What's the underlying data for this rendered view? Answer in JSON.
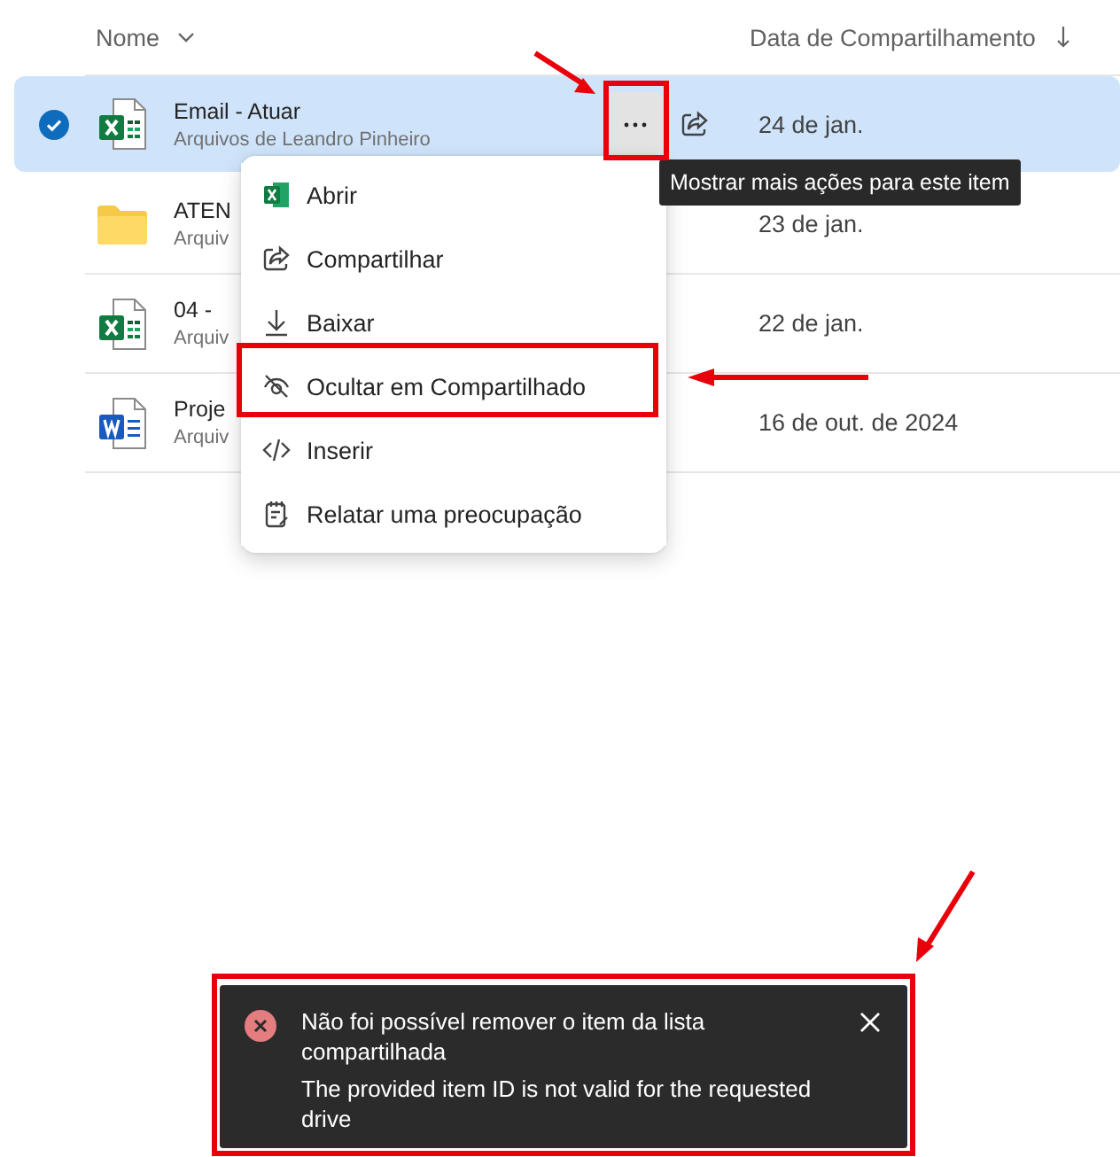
{
  "header": {
    "name_column": "Nome",
    "date_column": "Data de Compartilhamento"
  },
  "rows": [
    {
      "kind": "excel",
      "name": "Email - Atuar",
      "owner": "Arquivos de Leandro Pinheiro",
      "date": "24 de jan.",
      "selected": true
    },
    {
      "kind": "folder",
      "name": "ATEN",
      "owner": "Arquiv",
      "date": "23 de jan.",
      "selected": false
    },
    {
      "kind": "excel",
      "name": "04 -",
      "owner": "Arquiv",
      "date": "22 de jan.",
      "selected": false
    },
    {
      "kind": "word",
      "name": "Proje",
      "owner": "Arquiv",
      "date": "16 de out. de 2024",
      "selected": false
    }
  ],
  "context_menu": [
    {
      "kind": "excel",
      "label": "Abrir"
    },
    {
      "kind": "share",
      "label": "Compartilhar"
    },
    {
      "kind": "download",
      "label": "Baixar"
    },
    {
      "kind": "hide",
      "label": "Ocultar em Compartilhado"
    },
    {
      "kind": "embed",
      "label": "Inserir"
    },
    {
      "kind": "report",
      "label": "Relatar uma preocupação"
    }
  ],
  "tooltip": "Mostrar mais ações para este item",
  "toast": {
    "kind": "error",
    "title": "Não foi possível remover o item da lista compartilhada",
    "message": "The provided item ID is not valid for the requested drive"
  }
}
